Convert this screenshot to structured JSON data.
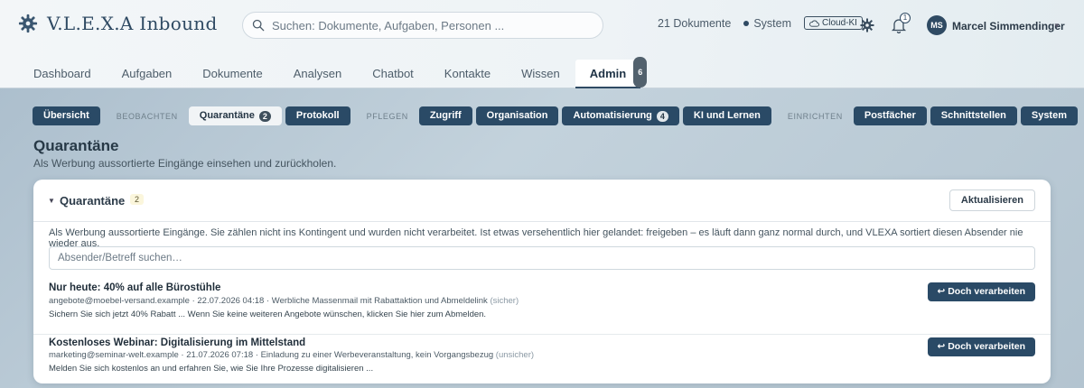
{
  "brand": {
    "name": "V.L.E.X.A Inbound",
    "logo_icon": "gear-logo-icon"
  },
  "search": {
    "placeholder": "Suchen: Dokumente, Aufgaben, Personen ..."
  },
  "header": {
    "doc_count": "21 Dokumente",
    "system_label": "System",
    "cloud_badge": "Cloud-KI",
    "notification_count": "1",
    "user_initials": "MS",
    "user_name": "Marcel Simmendinger"
  },
  "tabs": [
    {
      "label": "Dashboard"
    },
    {
      "label": "Aufgaben"
    },
    {
      "label": "Dokumente"
    },
    {
      "label": "Analysen"
    },
    {
      "label": "Chatbot"
    },
    {
      "label": "Kontakte"
    },
    {
      "label": "Wissen"
    },
    {
      "label": "Admin",
      "active": true,
      "badge": "6"
    }
  ],
  "subnav": {
    "overview": "Übersicht",
    "section_observe": "BEOBACHTEN",
    "quarantine": "Quarantäne",
    "quarantine_count": "2",
    "protocol": "Protokoll",
    "section_maintain": "PFLEGEN",
    "access": "Zugriff",
    "organisation": "Organisation",
    "automation": "Automatisierung",
    "automation_count": "4",
    "ai": "KI und Lernen",
    "section_setup": "EINRICHTEN",
    "mailboxes": "Postfächer",
    "interfaces": "Schnittstellen",
    "system": "System"
  },
  "section": {
    "title": "Quarantäne",
    "subtitle": "Als Werbung aussortierte Eingänge einsehen und zurückholen."
  },
  "card": {
    "title": "Quarantäne",
    "count": "2",
    "refresh_label": "Aktualisieren",
    "description": "Als Werbung aussortierte Eingänge. Sie zählen nicht ins Kontingent und wurden nicht verarbeitet. Ist etwas versehentlich hier gelandet: freigeben – es läuft dann ganz normal durch, und VLEXA sortiert diesen Absender nie wieder aus.",
    "search_placeholder": "Absender/Betreff suchen…",
    "items": [
      {
        "subject": "Nur heute: 40% auf alle Bürostühle",
        "meta": "angebote@moebel-versand.example · 22.07.2026 04:18 · Werbliche Massenmail mit Rabattaktion und Abmeldelink",
        "certainty": "(sicher)",
        "snippet": "Sichern Sie sich jetzt 40% Rabatt ... Wenn Sie keine weiteren Angebote wünschen, klicken Sie hier zum Abmelden.",
        "action": "↩ Doch verarbeiten"
      },
      {
        "subject": "Kostenloses Webinar: Digitalisierung im Mittelstand",
        "meta": "marketing@seminar-welt.example · 21.07.2026 07:18 · Einladung zu einer Werbeveranstaltung, kein Vorgangsbezug",
        "certainty": "(unsicher)",
        "snippet": "Melden Sie sich kostenlos an und erfahren Sie, wie Sie Ihre Prozesse digitalisieren ...",
        "action": "↩ Doch verarbeiten"
      }
    ]
  },
  "colors": {
    "primary": "#2a4a66",
    "page_bg": "#b3c4d0"
  }
}
